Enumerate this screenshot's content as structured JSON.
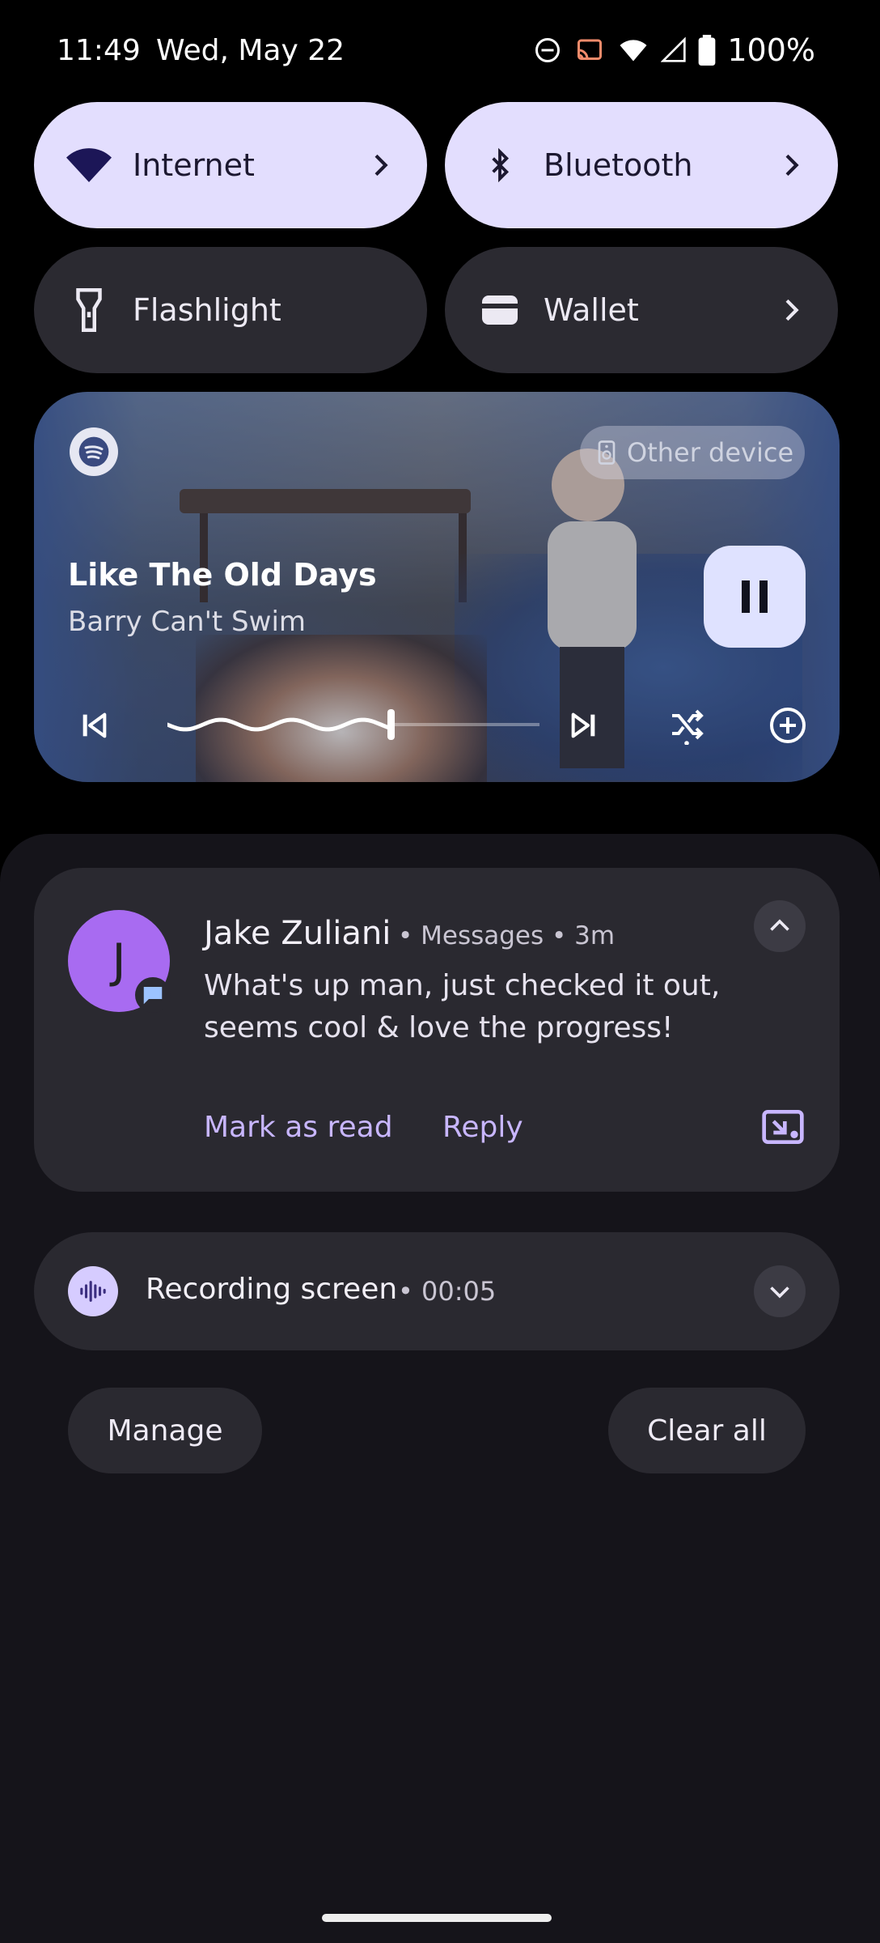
{
  "status_bar": {
    "time": "11:49",
    "date": "Wed, May 22",
    "battery": "100%"
  },
  "tiles": [
    {
      "label": "Internet",
      "state": "on"
    },
    {
      "label": "Bluetooth",
      "state": "on"
    },
    {
      "label": "Flashlight",
      "state": "off"
    },
    {
      "label": "Wallet",
      "state": "off"
    }
  ],
  "media": {
    "song": "Like The Old Days",
    "artist": "Barry Can't Swim",
    "device": "Other device",
    "progress": 0.6
  },
  "notification": {
    "sender_initial": "J",
    "sender": "Jake Zuliani",
    "app": "• Messages • 3m",
    "message": "What's up man, just checked it out, seems cool & love the progress!",
    "mark_read": "Mark as read",
    "reply": "Reply"
  },
  "recording": {
    "title": "Recording screen",
    "time": "• 00:05"
  },
  "buttons": {
    "manage": "Manage",
    "clear_all": "Clear all"
  },
  "colors": {
    "tile_on": "#e3defe",
    "tile_off": "#2b2a31",
    "accent": "#c8b6ff",
    "avatar": "#a86bf1"
  }
}
